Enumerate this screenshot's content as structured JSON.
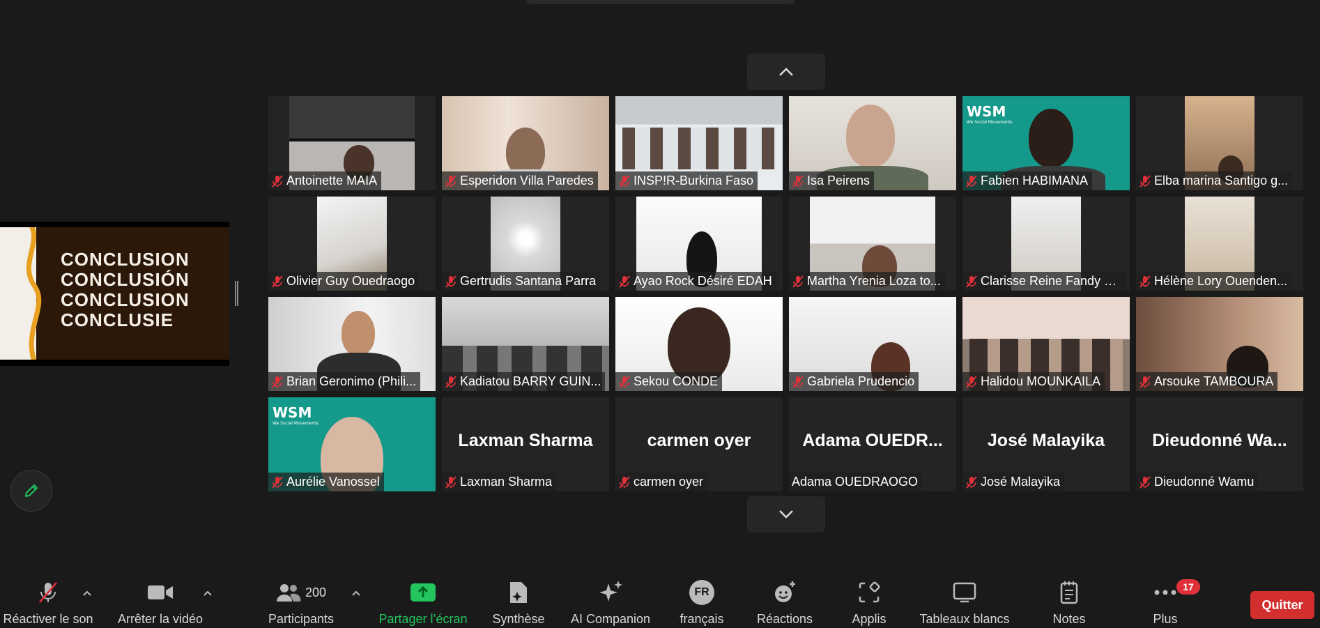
{
  "slide": {
    "lines": [
      "CONCLUSION",
      "CONCLUSIÓN",
      "CONCLUSION",
      "CONCLUSIE"
    ]
  },
  "participants": [
    {
      "name": "Antoinette MAIA",
      "muted": true
    },
    {
      "name": "Esperidon Villa Paredes",
      "muted": true
    },
    {
      "name": "INSP!R-Burkina Faso",
      "muted": true
    },
    {
      "name": "Isa Peirens",
      "muted": true
    },
    {
      "name": "Fabien HABIMANA",
      "muted": true
    },
    {
      "name": "Elba marina Santigo  g...",
      "muted": true
    },
    {
      "name": "Olivier Guy Ouedraogo",
      "muted": true
    },
    {
      "name": "Gertrudis Santana Parra",
      "muted": true
    },
    {
      "name": "Ayao Rock Désiré EDAH",
      "muted": true
    },
    {
      "name": "Martha Yrenia Loza to...",
      "muted": true
    },
    {
      "name": "Clarisse Reine Fandy G...",
      "muted": true
    },
    {
      "name": "Hélène Lory Ouenden...",
      "muted": true
    },
    {
      "name": "Brian Geronimo (Phili...",
      "muted": true
    },
    {
      "name": "Kadiatou BARRY GUIN...",
      "muted": true
    },
    {
      "name": "Sekou CONDE",
      "muted": true
    },
    {
      "name": "Gabriela Prudencio",
      "muted": true
    },
    {
      "name": "Halidou MOUNKAILA",
      "muted": true
    },
    {
      "name": "Arsouke TAMBOURA",
      "muted": true
    },
    {
      "name": "Aurélie Vanossel",
      "muted": true
    },
    {
      "name": "Laxman Sharma",
      "muted": true,
      "display": "Laxman Sharma"
    },
    {
      "name": "carmen oyer",
      "muted": true,
      "display": "carmen oyer"
    },
    {
      "name": "Adama OUEDRAOGO",
      "muted": false,
      "display": "Adama  OUEDR..."
    },
    {
      "name": "José Malayika",
      "muted": true,
      "display": "José Malayika"
    },
    {
      "name": "Dieudonné Wamu",
      "muted": true,
      "display": "Dieudonné  Wa..."
    }
  ],
  "wsm": {
    "logo": "WSM",
    "tagline": "We Social Movements"
  },
  "toolbar": {
    "unmute": "Réactiver le son",
    "stop_video": "Arrêter la vidéo",
    "participants": "Participants",
    "participants_count": "200",
    "share": "Partager l’écran",
    "summary": "Synthèse",
    "ai": "AI Companion",
    "lang_badge": "FR",
    "lang": "français",
    "reactions": "Réactions",
    "apps": "Applis",
    "whiteboards": "Tableaux blancs",
    "notes": "Notes",
    "more": "Plus",
    "more_badge": "17",
    "quit": "Quitter"
  },
  "colors": {
    "quit": "#d32f2f",
    "share_green": "#22c55e",
    "wsm_teal": "#14998a",
    "badge": "#e0313b"
  }
}
